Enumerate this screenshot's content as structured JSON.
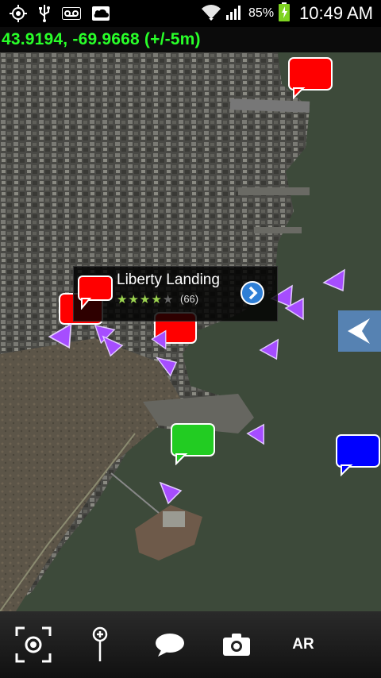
{
  "status_bar": {
    "icons": [
      "location-icon",
      "usb-icon",
      "voicemail-icon",
      "cloud-icon",
      "wifi-icon",
      "signal-icon",
      "battery-charging-icon"
    ],
    "battery_percent": "85%",
    "time": "10:49 AM"
  },
  "location": {
    "coordinates": "43.9194, -69.9668 (+/-5m)"
  },
  "map": {
    "markers": [
      {
        "name": "red-speech-marker",
        "color": "#ff0000"
      },
      {
        "name": "green-speech-marker",
        "color": "#22cc22"
      },
      {
        "name": "blue-speech-marker",
        "color": "#0000ff"
      },
      {
        "name": "purple-arrow-marker",
        "color": "#a64dff"
      }
    ]
  },
  "callout": {
    "title": "Liberty Landing",
    "rating": 4,
    "rating_max": 5,
    "rating_count": "(66)",
    "go_icon": "chevron-right-circle-icon"
  },
  "side_panel": {
    "icon": "chevron-left-icon",
    "color": "#5a8cc8"
  },
  "toolbar": {
    "buttons": [
      "locate-me-icon",
      "pin-icon",
      "comment-icon",
      "camera-icon"
    ],
    "ar_label": "AR"
  },
  "colors": {
    "coordinate_text": "#29ff29",
    "water": "#3d4a3a",
    "toolbar": "#222222"
  }
}
